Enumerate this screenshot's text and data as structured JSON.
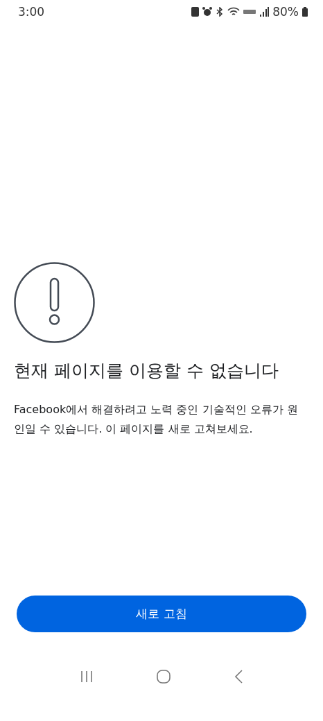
{
  "status_bar": {
    "time": "3:00",
    "battery": "80%"
  },
  "error": {
    "title": "현재 페이지를 이용할 수 없습니다",
    "message": "Facebook에서 해결하려고 노력 중인 기술적인 오류가 원인일 수 있습니다. 이 페이지를 새로 고쳐보세요."
  },
  "button": {
    "label": "새로 고침"
  }
}
